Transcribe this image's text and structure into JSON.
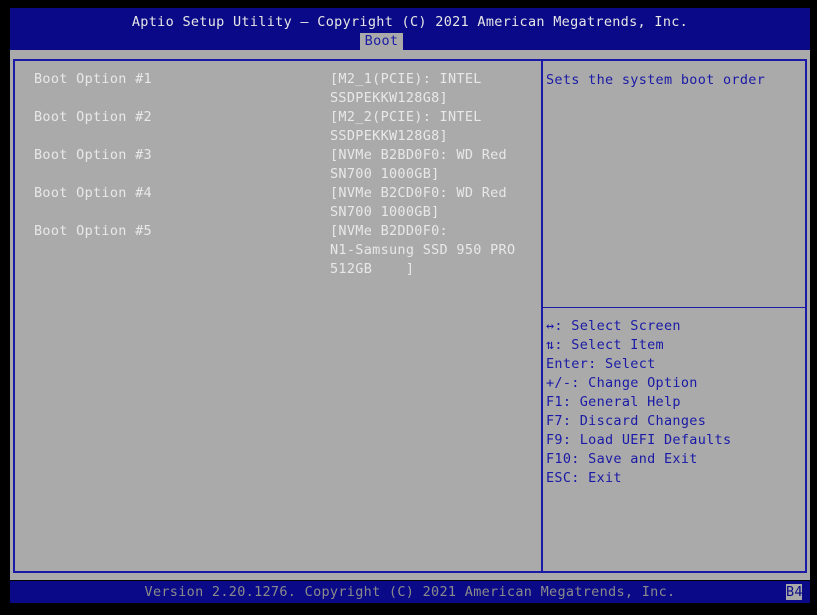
{
  "header": {
    "title": "Aptio Setup Utility – Copyright (C) 2021 American Megatrends, Inc.",
    "active_tab": "Boot"
  },
  "boot_options": [
    {
      "label": "Boot Option #1",
      "value_lines": [
        "[M2_1(PCIE): INTEL",
        "SSDPEKKW128G8]"
      ]
    },
    {
      "label": "Boot Option #2",
      "value_lines": [
        "[M2_2(PCIE): INTEL",
        "SSDPEKKW128G8]"
      ]
    },
    {
      "label": "Boot Option #3",
      "value_lines": [
        "[NVMe B2BD0F0: WD Red",
        "SN700 1000GB]"
      ]
    },
    {
      "label": "Boot Option #4",
      "value_lines": [
        "[NVMe B2CD0F0: WD Red",
        "SN700 1000GB]"
      ]
    },
    {
      "label": "Boot Option #5",
      "value_lines": [
        "[NVMe B2DD0F0:",
        "N1-Samsung SSD 950 PRO",
        "512GB    ]"
      ]
    }
  ],
  "help": {
    "description": "Sets the system boot order",
    "keys": [
      "↔: Select Screen",
      "⇅: Select Item",
      "Enter: Select",
      "+/-: Change Option",
      "F1: General Help",
      "F7: Discard Changes",
      "F9: Load UEFI Defaults",
      "F10: Save and Exit",
      "ESC: Exit"
    ]
  },
  "footer": {
    "version_text": "Version 2.20.1276. Copyright (C) 2021 American Megatrends, Inc.",
    "code": "B4"
  },
  "colors": {
    "header_blue": "#0a0a88",
    "panel_gray": "#aaaaaa",
    "help_text_blue": "#1a1aa6",
    "option_text": "#e8e8e8"
  }
}
